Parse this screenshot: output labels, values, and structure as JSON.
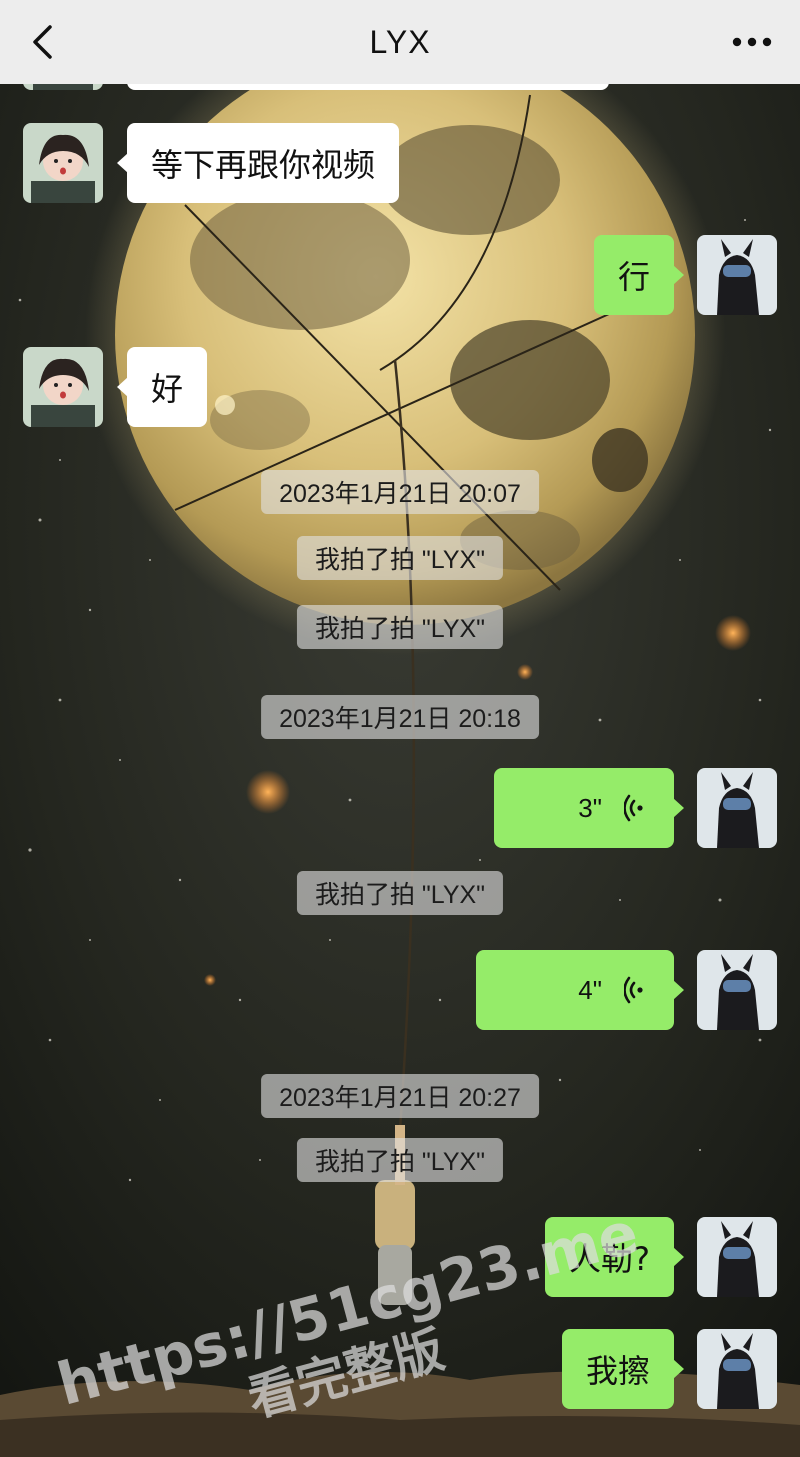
{
  "header": {
    "title": "LYX",
    "back_icon": "chevron-left-icon",
    "more_icon": "more-dots-icon"
  },
  "messages": {
    "m1": "等下再跟你视频",
    "m2": "行",
    "m3": "好",
    "m4_duration": "3\"",
    "m5_duration": "4\"",
    "m6": "人勒?",
    "m7": "我擦"
  },
  "system": {
    "t1": "2023年1月21日 20:07",
    "s1": "我拍了拍 \"LYX\"",
    "s2": "我拍了拍 \"LYX\"",
    "t2": "2023年1月21日 20:18",
    "s3": "我拍了拍 \"LYX\"",
    "t3": "2023年1月21日 20:27",
    "s4": "我拍了拍 \"LYX\""
  },
  "watermark": {
    "line1": "https://51cg23.me",
    "line2": "看完整版"
  },
  "colors": {
    "header_bg": "#ededed",
    "incoming_bubble": "#ffffff",
    "outgoing_bubble": "#95ec69",
    "system_notice_bg": "rgba(225,225,225,0.62)"
  }
}
